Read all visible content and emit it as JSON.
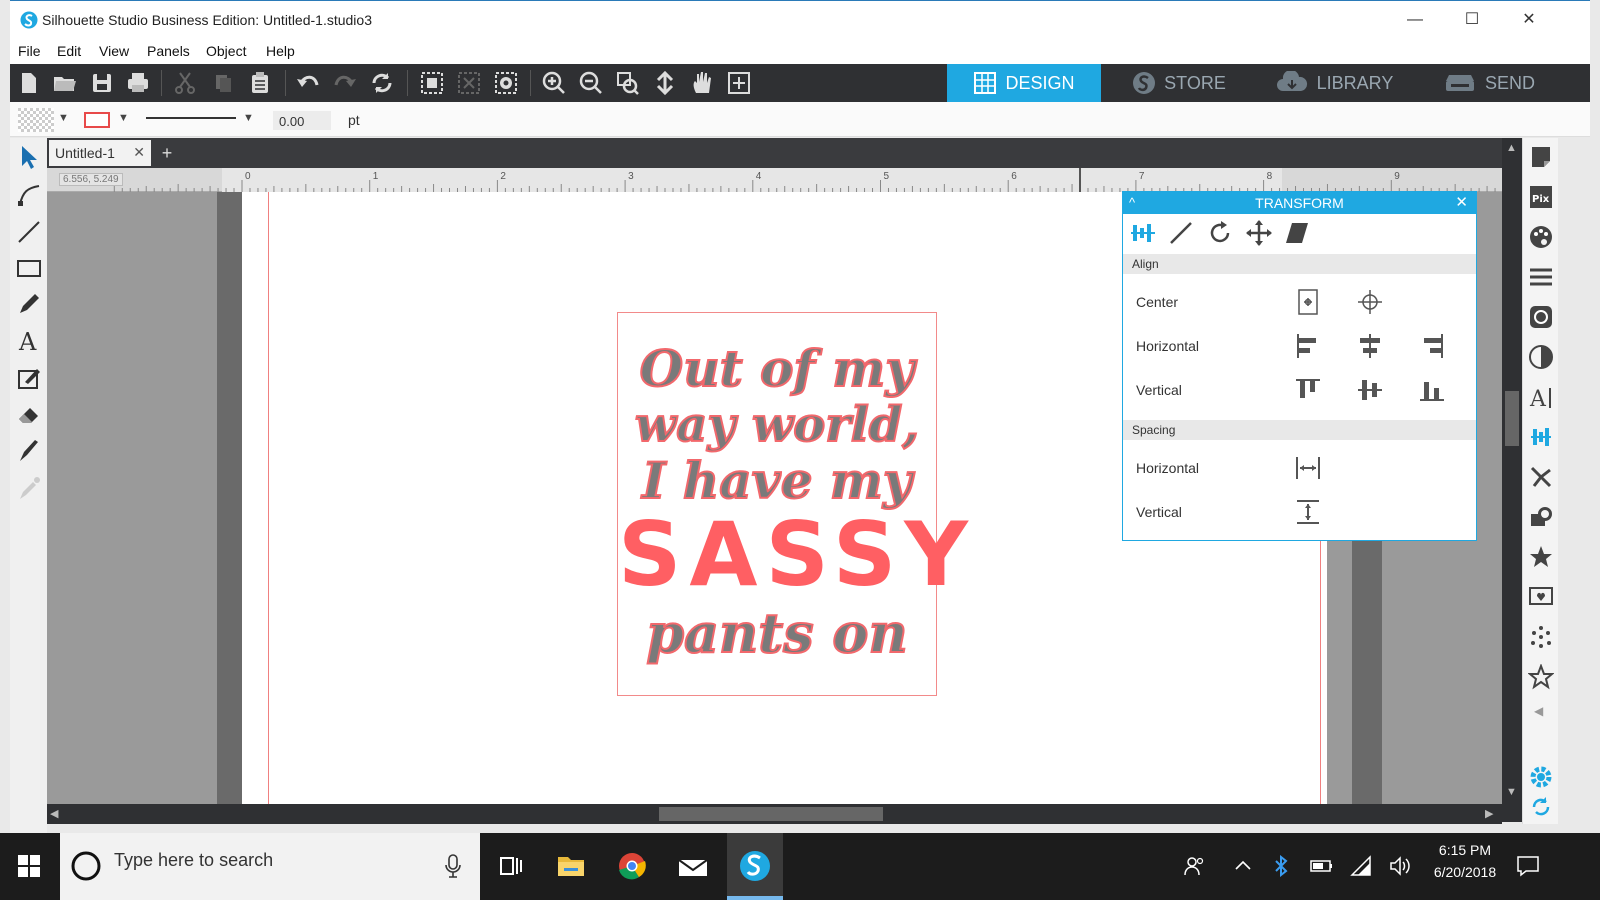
{
  "window": {
    "title": "Silhouette Studio Business Edition: Untitled-1.studio3",
    "minimize_glyph": "—",
    "maximize_glyph": "☐",
    "close_glyph": "✕"
  },
  "menu": [
    "File",
    "Edit",
    "View",
    "Panels",
    "Object",
    "Help"
  ],
  "nav_tabs": [
    {
      "label": "DESIGN",
      "icon": "grid-icon",
      "active": true
    },
    {
      "label": "STORE",
      "icon": "silhouette-s-icon",
      "active": false
    },
    {
      "label": "LIBRARY",
      "icon": "cloud-icon",
      "active": false
    },
    {
      "label": "SEND",
      "icon": "cutter-icon",
      "active": false
    }
  ],
  "properties": {
    "line_width_value": "0.00",
    "line_width_unit": "pt",
    "line_color": "#e84a4a"
  },
  "document": {
    "tab_label": "Untitled-1",
    "tab_close": "✕",
    "add_tab": "+",
    "cursor_coords": "6.556, 5.249"
  },
  "ruler": {
    "labels": [
      "0",
      "1",
      "2",
      "3",
      "4",
      "5",
      "6",
      "7",
      "8",
      "9"
    ]
  },
  "design": {
    "lines": [
      "Out of my",
      "way world,",
      "I have my"
    ],
    "highlight": "SASSY",
    "last_line": "pants on",
    "text_color": "#7a7a7a",
    "accent_color": "#ff5f63"
  },
  "transform_panel": {
    "title": "TRANSFORM",
    "collapse_glyph": "^",
    "close_glyph": "✕",
    "sections": {
      "align": "Align",
      "spacing": "Spacing"
    },
    "rows": {
      "center": "Center",
      "horizontal": "Horizontal",
      "vertical": "Vertical",
      "spacing_horizontal": "Horizontal",
      "spacing_vertical": "Vertical"
    }
  },
  "taskbar": {
    "search_placeholder": "Type here to search",
    "time": "6:15 PM",
    "date": "6/20/2018"
  },
  "colors": {
    "accent": "#1fa8e1",
    "toolbar": "#2f3033",
    "guide": "#f08080"
  }
}
